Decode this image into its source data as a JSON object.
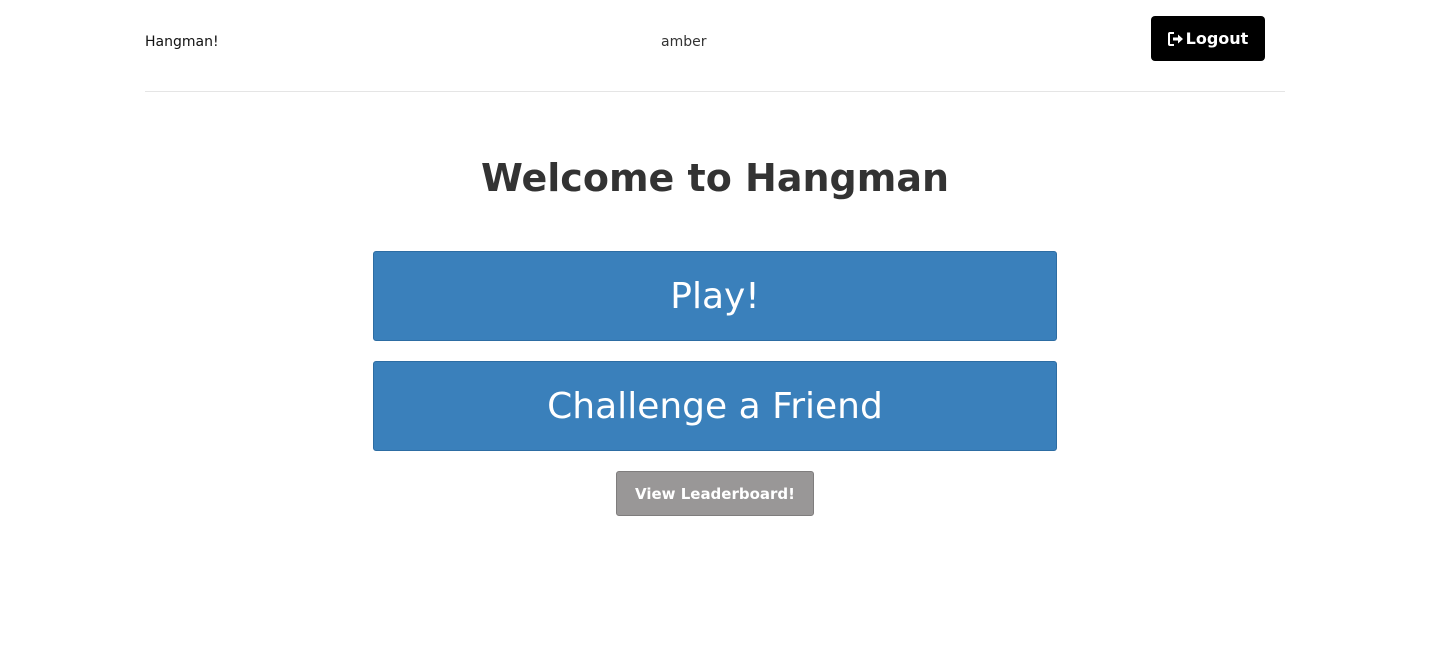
{
  "header": {
    "brand": "Hangman!",
    "username": "amber",
    "logout_label": "Logout",
    "logout_icon": "sign-out-icon"
  },
  "main": {
    "title": "Welcome to Hangman",
    "play_label": "Play!",
    "challenge_label": "Challenge a Friend",
    "leaderboard_label": "View Leaderboard!"
  },
  "colors": {
    "primary_button": "#3a80bb",
    "secondary_button": "#999797",
    "logout_button": "#000000"
  }
}
